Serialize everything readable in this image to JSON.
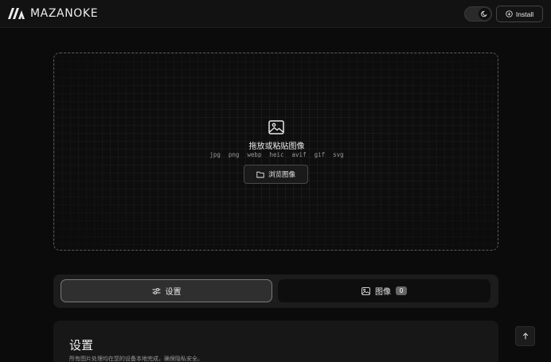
{
  "header": {
    "brand": "MAZANOKE",
    "install_label": "Install",
    "theme_toggle_icon": "moon-icon",
    "install_icon": "download-circle-icon"
  },
  "dropzone": {
    "icon": "image-icon",
    "title": "拖放或粘贴图像",
    "formats": [
      "jpg",
      "png",
      "webp",
      "heic",
      "avif",
      "gif",
      "svg"
    ],
    "browse_label": "浏览图像",
    "browse_icon": "folder-icon"
  },
  "tabs": {
    "settings_label": "设置",
    "settings_icon": "sliders-icon",
    "images_label": "图像",
    "images_icon": "image-icon",
    "images_count": "0",
    "active": "settings"
  },
  "settings": {
    "title": "设置",
    "subtitle": "所有图片处理均在您的设备本地完成，确保隐私安全。"
  },
  "colors": {
    "background": "#0b0b0b",
    "surface": "#1c1c1c",
    "accent_border": "#7a7a7a"
  }
}
